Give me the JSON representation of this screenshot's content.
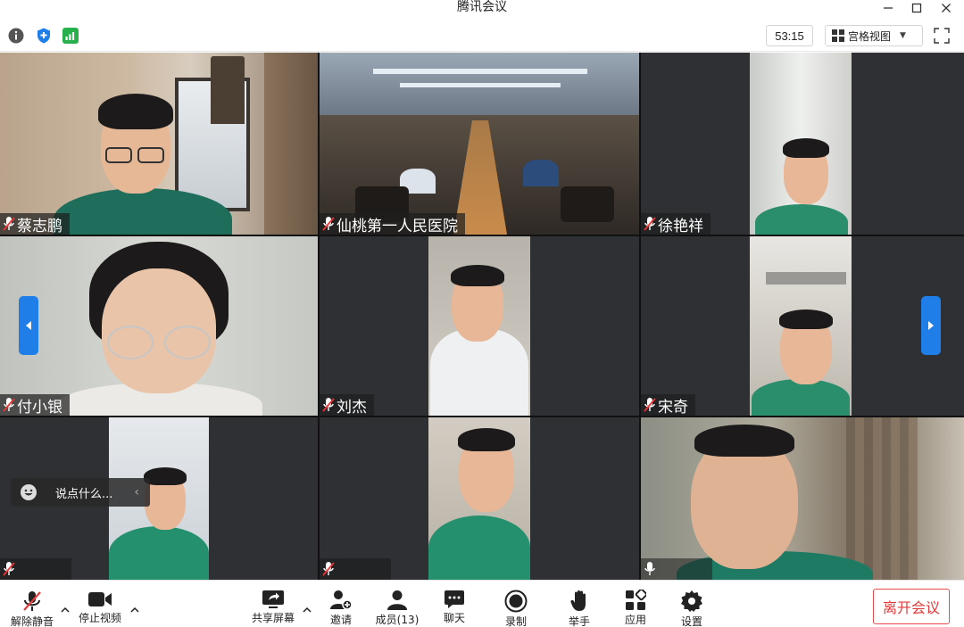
{
  "window": {
    "title": "腾讯会议"
  },
  "statusbar": {
    "icons": [
      "info-icon",
      "shield-icon",
      "signal-icon"
    ],
    "timer": "53:15",
    "view_label": "宫格视图"
  },
  "participants": [
    {
      "name": "蔡志鹏",
      "muted": true
    },
    {
      "name": "仙桃第一人民医院",
      "muted": true
    },
    {
      "name": "徐艳祥",
      "muted": true
    },
    {
      "name": "付小银",
      "muted": true
    },
    {
      "name": "刘杰",
      "muted": true
    },
    {
      "name": "宋奇",
      "muted": true
    },
    {
      "name": "",
      "muted": true
    },
    {
      "name": "",
      "muted": true
    },
    {
      "name": "",
      "muted": false
    }
  ],
  "chat": {
    "placeholder": "说点什么..."
  },
  "toolbar": {
    "unmute": "解除静音",
    "stop_video": "停止视频",
    "share_screen": "共享屏幕",
    "invite": "邀请",
    "members": "成员(13)",
    "chat": "聊天",
    "record": "录制",
    "raise_hand": "举手",
    "apps": "应用",
    "settings": "设置",
    "leave": "离开会议"
  },
  "colors": {
    "accent": "#1f7ee8",
    "leave": "#e23b3b",
    "speaking": "#3cc36b",
    "signal": "#27b04b"
  }
}
